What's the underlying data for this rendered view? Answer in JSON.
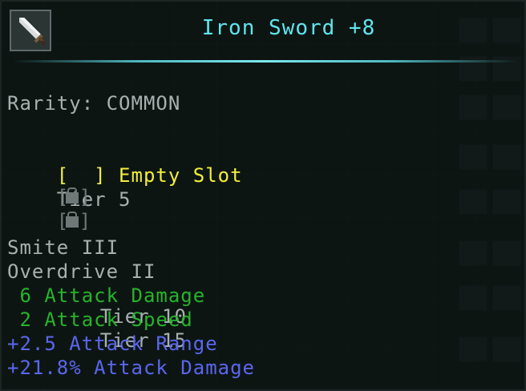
{
  "item": {
    "icon": "iron-sword-icon",
    "name": "Iron Sword +8"
  },
  "rarity_line": "Rarity: COMMON",
  "slots": [
    {
      "state": "empty",
      "label": "[  ] Empty Slot",
      "tier": "Tier 5"
    },
    {
      "state": "locked",
      "icon": "padlock-icon",
      "tier": "Tier 10"
    },
    {
      "state": "locked",
      "icon": "padlock-icon",
      "tier": "Tier 15"
    }
  ],
  "enchantments": [
    "Smite III",
    "Overdrive II"
  ],
  "attributes": [
    {
      "text": " 6 Attack Damage",
      "color": "#27b42b"
    },
    {
      "text": " 2 Attack Speed",
      "color": "#27b42b"
    },
    {
      "text": "+2.5 Attack Range",
      "color": "#5a67ef"
    },
    {
      "text": "+21.8% Attack Damage",
      "color": "#5a67ef"
    }
  ],
  "colors": {
    "title": "#5fe6ee",
    "empty_slot": "#f3ef3a",
    "text": "#a9b1b0"
  }
}
